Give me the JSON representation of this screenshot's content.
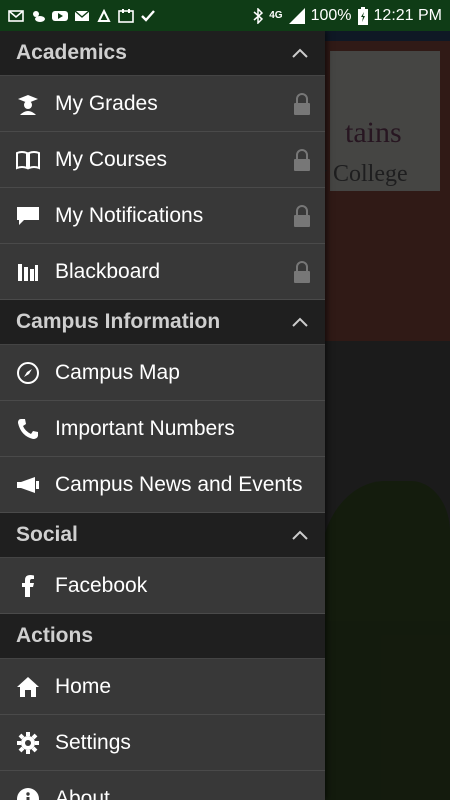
{
  "status": {
    "battery": "100%",
    "time": "12:21 PM",
    "network": "4G"
  },
  "background": {
    "sign_line1": "tains",
    "sign_line2": "y College"
  },
  "sections": {
    "academics": {
      "title": "Academics",
      "items": [
        {
          "label": "My Grades",
          "icon": "graduate-icon",
          "locked": true
        },
        {
          "label": "My Courses",
          "icon": "book-icon",
          "locked": true
        },
        {
          "label": "My Notifications",
          "icon": "chat-bubble-icon",
          "locked": true
        },
        {
          "label": "Blackboard",
          "icon": "library-icon",
          "locked": true
        }
      ]
    },
    "campus": {
      "title": "Campus Information",
      "items": [
        {
          "label": "Campus Map",
          "icon": "compass-icon"
        },
        {
          "label": "Important Numbers",
          "icon": "phone-icon"
        },
        {
          "label": "Campus News and Events",
          "icon": "megaphone-icon"
        }
      ]
    },
    "social": {
      "title": "Social",
      "items": [
        {
          "label": "Facebook",
          "icon": "facebook-icon"
        }
      ]
    },
    "actions": {
      "title": "Actions",
      "items": [
        {
          "label": "Home",
          "icon": "home-icon"
        },
        {
          "label": "Settings",
          "icon": "gear-icon"
        },
        {
          "label": "About",
          "icon": "info-icon"
        }
      ]
    }
  }
}
